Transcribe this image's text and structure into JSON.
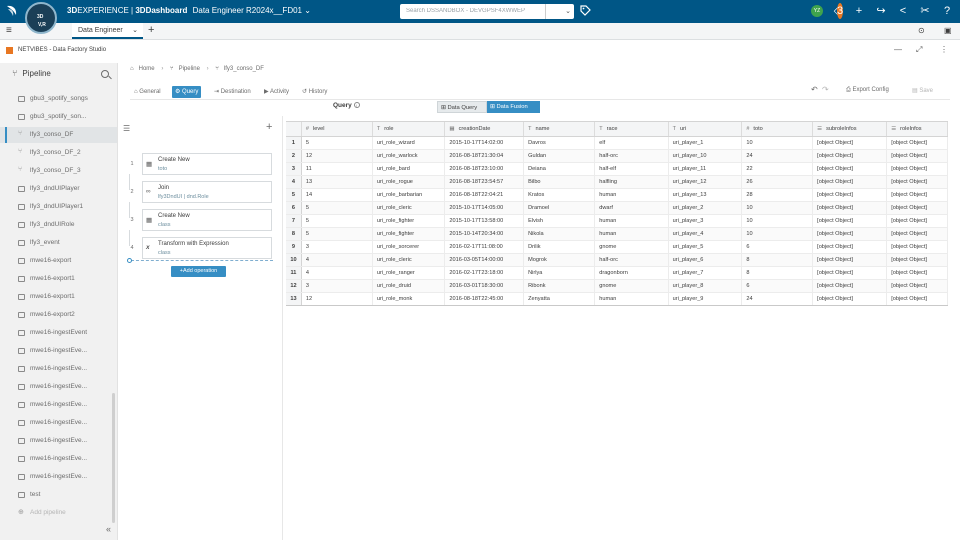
{
  "topbar": {
    "compass_top": "3D",
    "compass_bottom": "V,R",
    "brand_bold": "3D",
    "brand_product": "EXPERIENCE",
    "brand_sep": " | ",
    "brand_dash": "3DDashboard",
    "brand_context": "Data Engineer R2024x__FD01",
    "search_placeholder": "Search DSSANDBOX - DEVGPSF4XWWEP",
    "user_initials": "YZ",
    "notif_count": "3",
    "accent_color": "#005686"
  },
  "tabbar": {
    "active_tab": "Data Engineer",
    "add_tab": "+"
  },
  "app": {
    "title": "NETVIBES - Data Factory Studio"
  },
  "left_panel": {
    "title": "Pipeline",
    "items": [
      {
        "label": "gbu3_spotify_songs",
        "icon": "table-icon"
      },
      {
        "label": "gbu3_spotify_son...",
        "icon": "table-icon"
      },
      {
        "label": "lfy3_conso_DF",
        "icon": "flow-icon"
      },
      {
        "label": "lfy3_conso_DF_2",
        "icon": "flow-icon"
      },
      {
        "label": "lfy3_conso_DF_3",
        "icon": "flow-icon"
      },
      {
        "label": "lfy3_dndUIPlayer",
        "icon": "table-icon"
      },
      {
        "label": "lfy3_dndUIPlayer1",
        "icon": "table-icon"
      },
      {
        "label": "lfy3_dndUIRole",
        "icon": "table-icon"
      },
      {
        "label": "lfy3_event",
        "icon": "table-icon"
      },
      {
        "label": "mwe16-export",
        "icon": "table-icon"
      },
      {
        "label": "mwe16-export1",
        "icon": "table-icon"
      },
      {
        "label": "mwe16-export1",
        "icon": "table-icon"
      },
      {
        "label": "mwe16-export2",
        "icon": "table-icon"
      },
      {
        "label": "mwe16-ingestEvent",
        "icon": "table-icon"
      },
      {
        "label": "mwe16-ingestEve...",
        "icon": "table-icon"
      },
      {
        "label": "mwe16-ingestEve...",
        "icon": "table-icon"
      },
      {
        "label": "mwe16-ingestEve...",
        "icon": "table-icon"
      },
      {
        "label": "mwe16-ingestEve...",
        "icon": "table-icon"
      },
      {
        "label": "mwe16-ingestEve...",
        "icon": "table-icon"
      },
      {
        "label": "mwe16-ingestEve...",
        "icon": "table-icon"
      },
      {
        "label": "mwe16-ingestEve...",
        "icon": "table-icon"
      },
      {
        "label": "mwe16-ingestEve...",
        "icon": "table-icon"
      },
      {
        "label": "test",
        "icon": "table-icon"
      },
      {
        "label": "Add pipeline",
        "icon": "add-icon"
      }
    ]
  },
  "breadcrumb": {
    "home": "Home",
    "pipeline": "Pipeline",
    "current": "lfy3_conso_DF"
  },
  "subtabs": {
    "general": "General",
    "query": "Query",
    "destination": "Destination",
    "activity": "Activity",
    "history": "History",
    "export_config": "Export Config",
    "save": "Save"
  },
  "query": {
    "label": "Query",
    "data_query": "Data Query",
    "data_fusion": "Data Fusion"
  },
  "operations": {
    "items": [
      {
        "num": "1",
        "title": "Create New",
        "sub": "toto",
        "icon": "table-icon"
      },
      {
        "num": "2",
        "title": "Join",
        "sub": "lfy3DndUI | dnd.Role",
        "icon": "join-icon"
      },
      {
        "num": "3",
        "title": "Create New",
        "sub": "class",
        "icon": "table-icon"
      },
      {
        "num": "4",
        "title": "Transform with Expression",
        "sub": "class",
        "icon": "function-icon"
      }
    ],
    "add_label": "+Add operation"
  },
  "table": {
    "columns": [
      {
        "name": "level",
        "type": "#"
      },
      {
        "name": "role",
        "type": "T"
      },
      {
        "name": "creationDate",
        "type": "cal"
      },
      {
        "name": "name",
        "type": "T"
      },
      {
        "name": "race",
        "type": "T"
      },
      {
        "name": "uri",
        "type": "T"
      },
      {
        "name": "toto",
        "type": "#"
      },
      {
        "name": "subroleInfos",
        "type": "list"
      },
      {
        "name": "roleInfos",
        "type": "list"
      }
    ],
    "rows": [
      [
        "1",
        "5",
        "uri_role_wizard",
        "2015-10-17T14:02:00",
        "Davros",
        "elf",
        "uri_player_1",
        "10",
        "[object Object]",
        "[object Object]"
      ],
      [
        "2",
        "12",
        "uri_role_warlock",
        "2016-08-18T21:30:04",
        "Guldan",
        "half-orc",
        "uri_player_10",
        "24",
        "[object Object]",
        "[object Object]"
      ],
      [
        "3",
        "11",
        "uri_role_bard",
        "2016-08-18T23:10:00",
        "Deiana",
        "half-elf",
        "uri_player_11",
        "22",
        "[object Object]",
        "[object Object]"
      ],
      [
        "4",
        "13",
        "uri_role_rogue",
        "2016-08-18T23:54:57",
        "Bilbo",
        "halfling",
        "uri_player_12",
        "26",
        "[object Object]",
        "[object Object]"
      ],
      [
        "5",
        "14",
        "uri_role_barbarian",
        "2016-08-18T22:04:21",
        "Kratos",
        "human",
        "uri_player_13",
        "28",
        "[object Object]",
        "[object Object]"
      ],
      [
        "6",
        "5",
        "uri_role_cleric",
        "2015-10-17T14:05:00",
        "Dramoel",
        "dwarf",
        "uri_player_2",
        "10",
        "[object Object]",
        "[object Object]"
      ],
      [
        "7",
        "5",
        "uri_role_fighter",
        "2015-10-17T13:58:00",
        "Elvish",
        "human",
        "uri_player_3",
        "10",
        "[object Object]",
        "[object Object]"
      ],
      [
        "8",
        "5",
        "uri_role_fighter",
        "2015-10-14T20:34:00",
        "Nikola",
        "human",
        "uri_player_4",
        "10",
        "[object Object]",
        "[object Object]"
      ],
      [
        "9",
        "3",
        "uri_role_sorcerer",
        "2016-02-17T11:08:00",
        "Drilik",
        "gnome",
        "uri_player_5",
        "6",
        "[object Object]",
        "[object Object]"
      ],
      [
        "10",
        "4",
        "uri_role_cleric",
        "2016-03-05T14:00:00",
        "Mogrok",
        "half-orc",
        "uri_player_6",
        "8",
        "[object Object]",
        "[object Object]"
      ],
      [
        "11",
        "4",
        "uri_role_ranger",
        "2016-02-17T23:18:00",
        "Nirlya",
        "dragonborn",
        "uri_player_7",
        "8",
        "[object Object]",
        "[object Object]"
      ],
      [
        "12",
        "3",
        "uri_role_druid",
        "2016-03-01T18:30:00",
        "Ribonk",
        "gnome",
        "uri_player_8",
        "6",
        "[object Object]",
        "[object Object]"
      ],
      [
        "13",
        "12",
        "uri_role_monk",
        "2016-08-18T22:45:00",
        "Zenyatta",
        "human",
        "uri_player_9",
        "24",
        "[object Object]",
        "[object Object]"
      ]
    ]
  }
}
